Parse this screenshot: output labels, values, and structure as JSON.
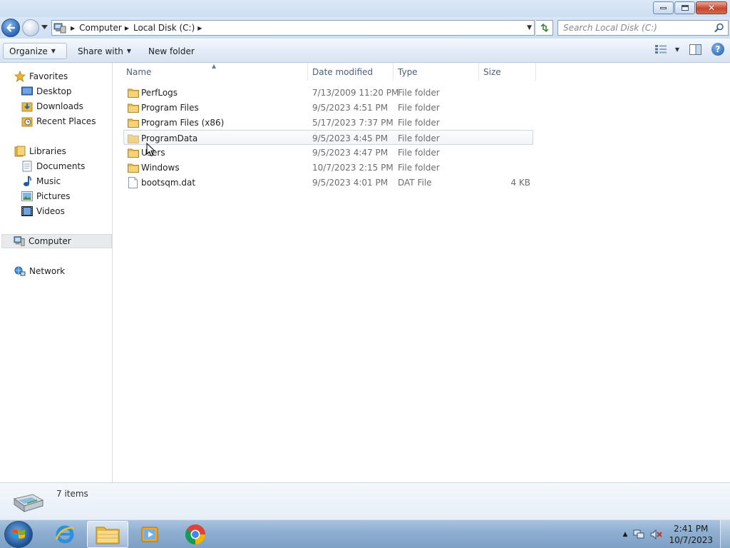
{
  "window": {
    "minimize_label": "Minimize",
    "maximize_label": "Maximize",
    "close_label": "Close"
  },
  "address_bar": {
    "breadcrumbs": [
      "Computer",
      "Local Disk (C:)"
    ],
    "search_placeholder": "Search Local Disk (C:)"
  },
  "toolbar": {
    "organize_label": "Organize",
    "share_label": "Share with",
    "new_folder_label": "New folder"
  },
  "nav_pane": {
    "favorites": {
      "label": "Favorites",
      "items": [
        {
          "label": "Desktop",
          "icon": "desktop-icon"
        },
        {
          "label": "Downloads",
          "icon": "downloads-icon"
        },
        {
          "label": "Recent Places",
          "icon": "recent-places-icon"
        }
      ]
    },
    "libraries": {
      "label": "Libraries",
      "items": [
        {
          "label": "Documents",
          "icon": "documents-icon"
        },
        {
          "label": "Music",
          "icon": "music-icon"
        },
        {
          "label": "Pictures",
          "icon": "pictures-icon"
        },
        {
          "label": "Videos",
          "icon": "videos-icon"
        }
      ]
    },
    "computer": {
      "label": "Computer"
    },
    "network": {
      "label": "Network"
    }
  },
  "file_list": {
    "columns": [
      "Name",
      "Date modified",
      "Type",
      "Size"
    ],
    "rows": [
      {
        "name": "PerfLogs",
        "date": "7/13/2009 11:20 PM",
        "type": "File folder",
        "size": "",
        "icon": "folder-icon"
      },
      {
        "name": "Program Files",
        "date": "9/5/2023 4:51 PM",
        "type": "File folder",
        "size": "",
        "icon": "folder-icon"
      },
      {
        "name": "Program Files (x86)",
        "date": "5/17/2023 7:37 PM",
        "type": "File folder",
        "size": "",
        "icon": "folder-icon"
      },
      {
        "name": "ProgramData",
        "date": "9/5/2023 4:45 PM",
        "type": "File folder",
        "size": "",
        "icon": "folder-icon"
      },
      {
        "name": "Users",
        "date": "9/5/2023 4:47 PM",
        "type": "File folder",
        "size": "",
        "icon": "folder-icon"
      },
      {
        "name": "Windows",
        "date": "10/7/2023 2:15 PM",
        "type": "File folder",
        "size": "",
        "icon": "folder-icon"
      },
      {
        "name": "bootsqm.dat",
        "date": "9/5/2023 4:01 PM",
        "type": "DAT File",
        "size": "4 KB",
        "icon": "file-icon"
      }
    ]
  },
  "details_pane": {
    "item_count": "7 items"
  },
  "taskbar": {
    "apps": [
      "internet-explorer-icon",
      "file-explorer-icon",
      "media-player-icon",
      "chrome-icon"
    ],
    "time": "2:41 PM",
    "date": "10/7/2023"
  },
  "colors": {
    "accent": "#2a64b6",
    "folder": "#e8b845",
    "hover_row": "#cbd6e4",
    "selected_nav": "#e8eaec"
  }
}
